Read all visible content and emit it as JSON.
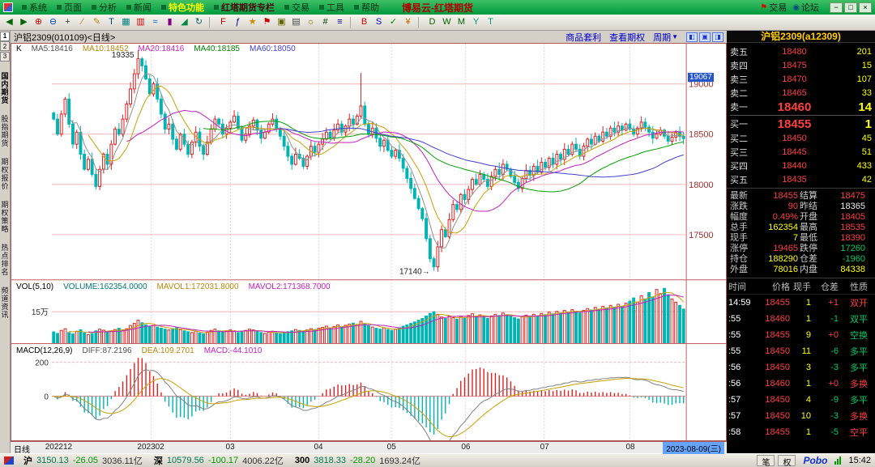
{
  "menu": {
    "title": "博易云-红塔期货",
    "items": [
      {
        "label": "系统"
      },
      {
        "label": "页面"
      },
      {
        "label": "分析"
      },
      {
        "label": "新闻"
      },
      {
        "label": "特色功能",
        "hl": "yellow"
      },
      {
        "label": "红塔期货专栏",
        "hl": "dark"
      },
      {
        "label": "交易"
      },
      {
        "label": "工具"
      },
      {
        "label": "帮助"
      }
    ],
    "right": [
      {
        "label": "交易"
      },
      {
        "label": "论坛"
      }
    ],
    "window_buttons": [
      "−",
      "□",
      "×"
    ]
  },
  "toolbar": {
    "icons": [
      {
        "n": "back-icon",
        "g": "◀",
        "c": "#006600"
      },
      {
        "n": "forward-icon",
        "g": "▶",
        "c": "#006600"
      },
      {
        "n": "zoom-in-icon",
        "g": "⊕",
        "c": "#cc0000"
      },
      {
        "n": "zoom-out-icon",
        "g": "⊖",
        "c": "#0044cc"
      },
      {
        "n": "crosshair-icon",
        "g": "+",
        "c": "#333333"
      },
      {
        "n": "trendline-icon",
        "g": "∕",
        "c": "#cc6600"
      },
      {
        "n": "pencil-icon",
        "g": "✎",
        "c": "#b8860b"
      },
      {
        "n": "text-tool-icon",
        "g": "T",
        "c": "#004488"
      },
      {
        "n": "grid-icon",
        "g": "▦",
        "c": "#008080"
      },
      {
        "n": "candle-chart-icon",
        "g": "▥",
        "c": "#cc0000"
      },
      {
        "n": "line-chart-icon",
        "g": "≈",
        "c": "#0066cc"
      },
      {
        "n": "bar-chart-icon",
        "g": "▮",
        "c": "#880088"
      },
      {
        "n": "area-chart-icon",
        "g": "◢",
        "c": "#008844"
      },
      {
        "n": "refresh-icon",
        "g": "↻",
        "c": "#006666"
      },
      {
        "n": "sep1",
        "sep": true
      },
      {
        "n": "fkey-icon",
        "g": "F",
        "c": "#cc0000"
      },
      {
        "n": "formula-icon",
        "g": "ƒ",
        "c": "#0000aa"
      },
      {
        "n": "star-icon",
        "g": "★",
        "c": "#cc8800"
      },
      {
        "n": "flag-icon",
        "g": "⚑",
        "c": "#cc0000"
      },
      {
        "n": "lock-icon",
        "g": "▣",
        "c": "#666600"
      },
      {
        "n": "print-icon",
        "g": "▤",
        "c": "#444444"
      },
      {
        "n": "settings-icon",
        "g": "☼",
        "c": "#886600"
      },
      {
        "n": "calculator-icon",
        "g": "#",
        "c": "#004400"
      },
      {
        "n": "news-icon",
        "g": "≡",
        "c": "#000088"
      },
      {
        "n": "sep2",
        "sep": true
      },
      {
        "n": "buy-icon",
        "g": "B",
        "c": "#cc0000"
      },
      {
        "n": "sell-icon",
        "g": "S",
        "c": "#0000cc"
      },
      {
        "n": "order-confirm-icon",
        "g": "✓",
        "c": "#008800"
      },
      {
        "n": "money-icon",
        "g": "¥",
        "c": "#cc6600"
      },
      {
        "n": "sep3",
        "sep": true
      },
      {
        "n": "period-day-icon",
        "g": "D",
        "c": "#006600"
      },
      {
        "n": "period-week-icon",
        "g": "W",
        "c": "#006600"
      },
      {
        "n": "period-minute-icon",
        "g": "M",
        "c": "#006600"
      },
      {
        "n": "y-tool-icon",
        "g": "Y",
        "c": "#009988"
      },
      {
        "n": "t-tool-icon",
        "g": "T",
        "c": "#009988"
      }
    ]
  },
  "sidebar": {
    "pages": [
      "1",
      "2",
      "3"
    ],
    "tabs": [
      "国内期货",
      "股指期货",
      "期权报价",
      "期权策略",
      "热点排名",
      "频道资讯"
    ]
  },
  "chart_header": {
    "symbol": "沪铝2309(010109)<日线>",
    "links": [
      "商品套利",
      "查看期权"
    ],
    "period": "周期",
    "layout_buttons": [
      "◧",
      "▣",
      "◨"
    ]
  },
  "indicators": {
    "k": "K",
    "ma_items": [
      {
        "t": "MA5:18416",
        "c": "#505050"
      },
      {
        "t": "MA10:18452",
        "c": "#b8860b"
      },
      {
        "t": "MA20:18416",
        "c": "#c020c0"
      },
      {
        "t": "MA40:18185",
        "c": "#008000"
      },
      {
        "t": "MA60:18050",
        "c": "#4040d0"
      }
    ],
    "vol_items": [
      {
        "t": "VOL(5,10)",
        "c": "#000000"
      },
      {
        "t": "VOLUME:162354.0000",
        "c": "#007777"
      },
      {
        "t": "MAVOL1:172031.8000",
        "c": "#b8860b"
      },
      {
        "t": "MAVOL2:171368.7000",
        "c": "#c020c0"
      }
    ],
    "macd_items": [
      {
        "t": "MACD(12,26,9)",
        "c": "#000000"
      },
      {
        "t": "DIFF:87.2196",
        "c": "#505050"
      },
      {
        "t": "DEA:109.2701",
        "c": "#b8860b"
      },
      {
        "t": "MACD:-44.1010",
        "c": "#c020c0"
      }
    ]
  },
  "chart_data": {
    "type": "candlestick",
    "title": "沪铝2309 日线",
    "closes": [
      18650,
      18500,
      18700,
      18850,
      18600,
      18400,
      18520,
      18300,
      18150,
      18250,
      18100,
      17980,
      18150,
      18300,
      18200,
      18400,
      18550,
      18500,
      18650,
      18800,
      18950,
      19100,
      19250,
      19180,
      19050,
      18900,
      19000,
      18850,
      18700,
      18550,
      18600,
      18450,
      18350,
      18500,
      18400,
      18300,
      18420,
      18520,
      18380,
      18300,
      18420,
      18550,
      18650,
      18600,
      18500,
      18560,
      18620,
      18680,
      18560,
      18440,
      18500,
      18580,
      18640,
      18540,
      18460,
      18520,
      18600,
      18650,
      18550,
      18480,
      18380,
      18280,
      18200,
      18300,
      18260,
      18180,
      18280,
      18380,
      18320,
      18400,
      18450,
      18520,
      18460,
      18540,
      18600,
      18520,
      18580,
      18650,
      18600,
      18680,
      18780,
      18600,
      18500,
      18560,
      18460,
      18380,
      18440,
      18340,
      18280,
      18340,
      18260,
      18160,
      18060,
      17960,
      17860,
      17760,
      17660,
      17460,
      17260,
      17180,
      17380,
      17550,
      17480,
      17650,
      17800,
      17750,
      17900,
      17850,
      17950,
      18050,
      18000,
      18100,
      18050,
      17980,
      18080,
      18150,
      18100,
      18200,
      18150,
      18080,
      18020,
      17960,
      18060,
      18140,
      18090,
      18180,
      18120,
      18220,
      18170,
      18260,
      18200,
      18300,
      18250,
      18350,
      18300,
      18400,
      18350,
      18280,
      18380,
      18450,
      18400,
      18480,
      18430,
      18520,
      18480,
      18560,
      18520,
      18580,
      18540,
      18600,
      18550,
      18500,
      18560,
      18620,
      18570,
      18520,
      18460,
      18500,
      18540,
      18480,
      18430,
      18470,
      18520,
      18480,
      18455
    ],
    "volumes": [
      55000,
      48000,
      62000,
      70000,
      52000,
      45000,
      58000,
      65000,
      50000,
      42000,
      47000,
      60000,
      68000,
      63000,
      55000,
      58000,
      66000,
      72000,
      64000,
      70000,
      85000,
      95000,
      110000,
      98000,
      88000,
      80000,
      86000,
      78000,
      72000,
      68000,
      64000,
      70000,
      75000,
      66000,
      60000,
      56000,
      52000,
      58000,
      50000,
      46000,
      54000,
      62000,
      68000,
      60000,
      55000,
      58000,
      64000,
      60000,
      52000,
      56000,
      62000,
      68000,
      64000,
      56000,
      52000,
      48000,
      54000,
      58000,
      50000,
      46000,
      50000,
      56000,
      60000,
      66000,
      62000,
      58000,
      64000,
      70000,
      66000,
      72000,
      76000,
      82000,
      74000,
      80000,
      88000,
      78000,
      86000,
      92000,
      96000,
      90000,
      105000,
      92000,
      84000,
      78000,
      72000,
      68000,
      74000,
      66000,
      62000,
      68000,
      75000,
      82000,
      88000,
      95000,
      102000,
      110000,
      118000,
      130000,
      142000,
      150000,
      138000,
      125000,
      118000,
      130000,
      122000,
      115000,
      128000,
      120000,
      132000,
      140000,
      128000,
      135000,
      126000,
      118000,
      130000,
      138000,
      132000,
      144000,
      136000,
      128000,
      122000,
      116000,
      126000,
      134000,
      128000,
      138000,
      130000,
      142000,
      136000,
      148000,
      140000,
      152000,
      144000,
      156000,
      148000,
      160000,
      152000,
      144000,
      156000,
      165000,
      158000,
      170000,
      162000,
      175000,
      168000,
      180000,
      172000,
      185000,
      176000,
      190000,
      200000,
      215000,
      195000,
      225000,
      210000,
      240000,
      220000,
      255000,
      235000,
      260000,
      230000,
      210000,
      195000,
      180000,
      162354
    ],
    "overrides": [
      {
        "i": 22,
        "high": 19335
      },
      {
        "i": 80,
        "high": 19110
      },
      {
        "i": 99,
        "low": 17140
      }
    ],
    "annotations": [
      {
        "i": 22,
        "label": "19335",
        "pos": "high"
      },
      {
        "i": 99,
        "label": "17140→",
        "pos": "low"
      }
    ],
    "y_axis": {
      "min": 17050,
      "max": 19400,
      "grid": [
        19000,
        18500,
        18000,
        17500
      ],
      "badge": "19067",
      "badge_value": 19067
    },
    "volume_axis": {
      "max": 300000,
      "grid_value": 150000,
      "grid_label": "15万"
    },
    "macd_axis": {
      "min": -260,
      "max": 310,
      "grid": [
        200,
        0
      ],
      "labels": [
        "200",
        "0"
      ]
    },
    "x_axis": {
      "period": "日线",
      "labels": [
        {
          "t": "202212",
          "f": 0.012
        },
        {
          "t": "202302",
          "f": 0.157
        },
        {
          "t": "03",
          "f": 0.282
        },
        {
          "t": "04",
          "f": 0.421
        },
        {
          "t": "05",
          "f": 0.536
        },
        {
          "t": "06",
          "f": 0.653
        },
        {
          "t": "07",
          "f": 0.777
        },
        {
          "t": "08",
          "f": 0.912
        }
      ],
      "date_badge": "2023-08-09(三)"
    },
    "colors": {
      "up": "#e02020",
      "down": "#00b4b4",
      "ma5": "#909090",
      "ma10": "#c8a000",
      "ma20": "#c020c0",
      "ma40": "#00a000",
      "ma60": "#4040d0",
      "mavol1": "#c8a000",
      "mavol2": "#c020c0",
      "diff": "#808080",
      "dea": "#c8a000"
    }
  },
  "quote": {
    "title": "沪铝2309(a12309)",
    "asks": [
      {
        "label": "卖五",
        "price": "18480",
        "qty": "201"
      },
      {
        "label": "卖四",
        "price": "18475",
        "qty": "15"
      },
      {
        "label": "卖三",
        "price": "18470",
        "qty": "107"
      },
      {
        "label": "卖二",
        "price": "18465",
        "qty": "33"
      },
      {
        "label": "卖一",
        "price": "18460",
        "qty": "14"
      }
    ],
    "bids": [
      {
        "label": "买一",
        "price": "18455",
        "qty": "1"
      },
      {
        "label": "买二",
        "price": "18450",
        "qty": "45"
      },
      {
        "label": "买三",
        "price": "18445",
        "qty": "51"
      },
      {
        "label": "买四",
        "price": "18440",
        "qty": "433"
      },
      {
        "label": "买五",
        "price": "18435",
        "qty": "42"
      }
    ],
    "stats": [
      {
        "l": "最新",
        "v": "18455",
        "c": "red"
      },
      {
        "l": "结算",
        "v": "18475",
        "c": "red"
      },
      {
        "l": "涨跌",
        "v": "90",
        "c": "red"
      },
      {
        "l": "昨结",
        "v": "18365",
        "c": "white"
      },
      {
        "l": "幅度",
        "v": "0.49%",
        "c": "red"
      },
      {
        "l": "开盘",
        "v": "18405",
        "c": "red"
      },
      {
        "l": "总手",
        "v": "162354",
        "c": "yellow"
      },
      {
        "l": "最高",
        "v": "18535",
        "c": "red"
      },
      {
        "l": "现手",
        "v": "7",
        "c": "yellow"
      },
      {
        "l": "最低",
        "v": "18390",
        "c": "red"
      },
      {
        "l": "涨停",
        "v": "19465",
        "c": "red"
      },
      {
        "l": "跌停",
        "v": "17260",
        "c": "green"
      },
      {
        "l": "持仓",
        "v": "188290",
        "c": "yellow"
      },
      {
        "l": "仓差",
        "v": "-1960",
        "c": "green"
      },
      {
        "l": "外盘",
        "v": "78016",
        "c": "yellow"
      },
      {
        "l": "内盘",
        "v": "84338",
        "c": "yellow"
      }
    ],
    "tick_header": [
      "时间",
      "价格",
      "现手",
      "仓差",
      "性质"
    ],
    "ticks": [
      {
        "t": "14:59",
        "p": "18455",
        "pc": "red",
        "v": "1",
        "o": "+1",
        "oc": "red",
        "n": "双开",
        "nc": "red"
      },
      {
        "t": ":55",
        "p": "18460",
        "pc": "red",
        "v": "1",
        "o": "-1",
        "oc": "green",
        "n": "双平",
        "nc": "green"
      },
      {
        "t": ":55",
        "p": "18455",
        "pc": "red",
        "v": "9",
        "o": "+0",
        "oc": "red",
        "n": "空换",
        "nc": "green"
      },
      {
        "t": ":55",
        "p": "18450",
        "pc": "red",
        "v": "11",
        "o": "-6",
        "oc": "green",
        "n": "多平",
        "nc": "green"
      },
      {
        "t": ":56",
        "p": "18450",
        "pc": "red",
        "v": "3",
        "o": "-3",
        "oc": "green",
        "n": "多平",
        "nc": "green"
      },
      {
        "t": ":56",
        "p": "18460",
        "pc": "red",
        "v": "1",
        "o": "+0",
        "oc": "red",
        "n": "多换",
        "nc": "red"
      },
      {
        "t": ":57",
        "p": "18450",
        "pc": "red",
        "v": "4",
        "o": "-9",
        "oc": "green",
        "n": "多平",
        "nc": "green"
      },
      {
        "t": ":57",
        "p": "18450",
        "pc": "red",
        "v": "10",
        "o": "-3",
        "oc": "green",
        "n": "多换",
        "nc": "red"
      },
      {
        "t": ":58",
        "p": "18455",
        "pc": "red",
        "v": "1",
        "o": "-5",
        "oc": "green",
        "n": "空平",
        "nc": "red"
      }
    ]
  },
  "status": {
    "indices": [
      {
        "name": "沪",
        "value": "3150.13",
        "change": "-26.05",
        "amount": "3036.11亿"
      },
      {
        "name": "深",
        "value": "10579.56",
        "change": "-100.17",
        "amount": "4006.22亿"
      },
      {
        "name": "300",
        "value": "3818.33",
        "change": "-28.20",
        "amount": "1693.24亿"
      }
    ],
    "tabs": [
      "笔",
      "权"
    ],
    "logo": "Pobo",
    "time": "15:42"
  }
}
